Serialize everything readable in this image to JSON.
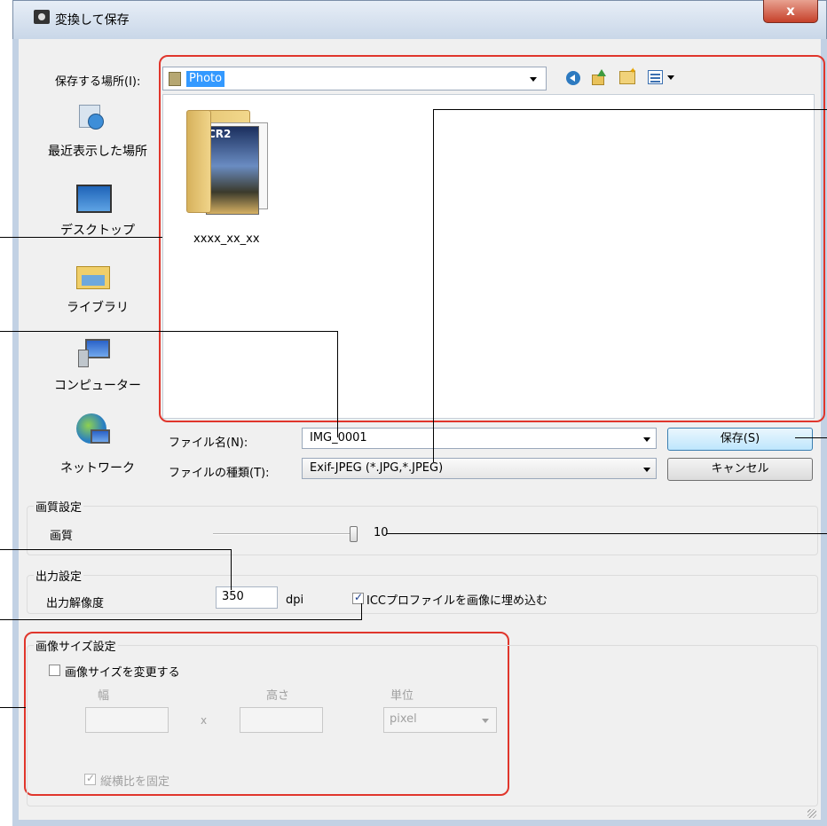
{
  "window": {
    "title": "変換して保存",
    "close_label": "x"
  },
  "location": {
    "label": "保存する場所(I):",
    "value": "Photo"
  },
  "places": [
    {
      "label": "最近表示した場所"
    },
    {
      "label": "デスクトップ"
    },
    {
      "label": "ライブラリ"
    },
    {
      "label": "コンピューター"
    },
    {
      "label": "ネットワーク"
    }
  ],
  "files": [
    {
      "name": "xxxx_xx_xx",
      "badge": "CR2"
    }
  ],
  "filename": {
    "label": "ファイル名(N):",
    "value": "IMG_0001"
  },
  "filetype": {
    "label": "ファイルの種類(T):",
    "value": "Exif-JPEG (*.JPG,*.JPEG)"
  },
  "buttons": {
    "save": "保存(S)",
    "cancel": "キャンセル"
  },
  "quality": {
    "group_label": "画質設定",
    "label": "画質",
    "value": "10",
    "level": 10,
    "max": 10
  },
  "output": {
    "group_label": "出力設定",
    "resolution_label": "出力解像度",
    "resolution_value": "350",
    "unit": "dpi",
    "icc_label": "ICCプロファイルを画像に埋め込む",
    "icc_checked": true
  },
  "image_size": {
    "group_label": "画像サイズ設定",
    "resize_label": "画像サイズを変更する",
    "resize_checked": false,
    "width_label": "幅",
    "height_label": "高さ",
    "times": "x",
    "unit_label": "単位",
    "unit_value": "pixel",
    "aspect_label": "縦横比を固定",
    "aspect_checked": true
  },
  "colors": {
    "highlight": "#e0362c",
    "selection": "#3399ff",
    "titlebar": "#c9d7e8"
  }
}
